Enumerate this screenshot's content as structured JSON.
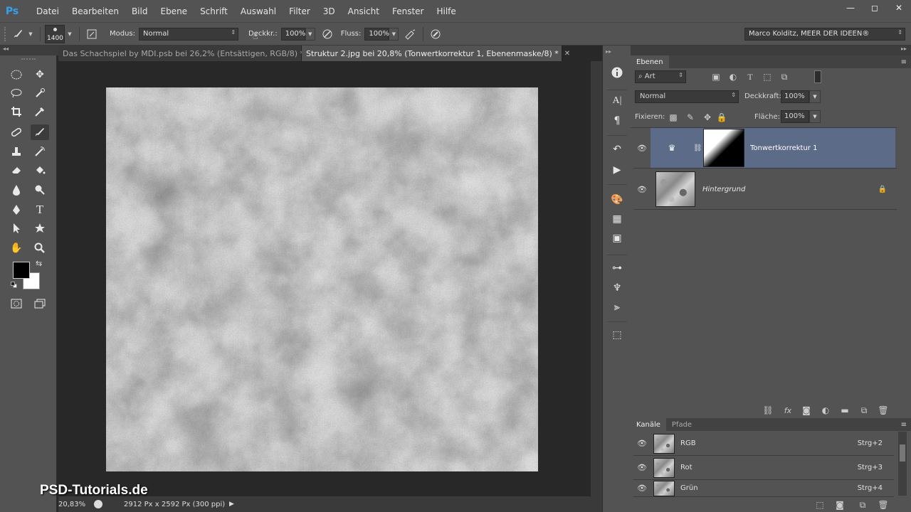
{
  "app": {
    "logo": "Ps"
  },
  "menu": [
    "Datei",
    "Bearbeiten",
    "Bild",
    "Ebene",
    "Schrift",
    "Auswahl",
    "Filter",
    "3D",
    "Ansicht",
    "Fenster",
    "Hilfe"
  ],
  "window_controls": {
    "minimize": "—",
    "restore": "◻",
    "close": "✕"
  },
  "options": {
    "brush_size": "1400",
    "modus_label": "Modus:",
    "modus_value": "Normal",
    "deckkr_label": "Deckkr.:",
    "deckkr_value": "100%",
    "fluss_label": "Fluss:",
    "fluss_value": "100%",
    "workspace": "Marco Kolditz, MEER DER IDEEN®"
  },
  "tabs": [
    {
      "label": "Das Schachspiel by MDI.psb bei 26,2% (Entsättigen, RGB/8) *",
      "close": "✕"
    },
    {
      "label": "Struktur 2.jpg bei 20,8% (Tonwertkorrektur 1, Ebenenmaske/8) *",
      "close": "✕"
    }
  ],
  "status": {
    "zoom": "20,83%",
    "doc_info": "2912 Px x 2592 Px (300 ppi)",
    "arrow": "▶"
  },
  "watermark": "PSD-Tutorials.de",
  "layers_panel": {
    "title": "Ebenen",
    "filter_label": "Art",
    "blend_mode": "Normal",
    "opacity_label": "Deckkraft:",
    "opacity_value": "100%",
    "lock_label": "Fixieren:",
    "fill_label": "Fläche:",
    "fill_value": "100%",
    "layers": [
      {
        "name": "Tonwertkorrektur 1",
        "selected": true
      },
      {
        "name": "Hintergrund",
        "selected": false
      }
    ]
  },
  "channels_panel": {
    "tabs": [
      "Kanäle",
      "Pfade"
    ],
    "channels": [
      {
        "name": "RGB",
        "shortcut": "Strg+2"
      },
      {
        "name": "Rot",
        "shortcut": "Strg+3"
      },
      {
        "name": "Grün",
        "shortcut": "Strg+4"
      }
    ]
  },
  "colors": {
    "selected_layer": "#5c6b87",
    "accent": "#2fa3f0",
    "foreground": "#000000",
    "background": "#ffffff"
  }
}
